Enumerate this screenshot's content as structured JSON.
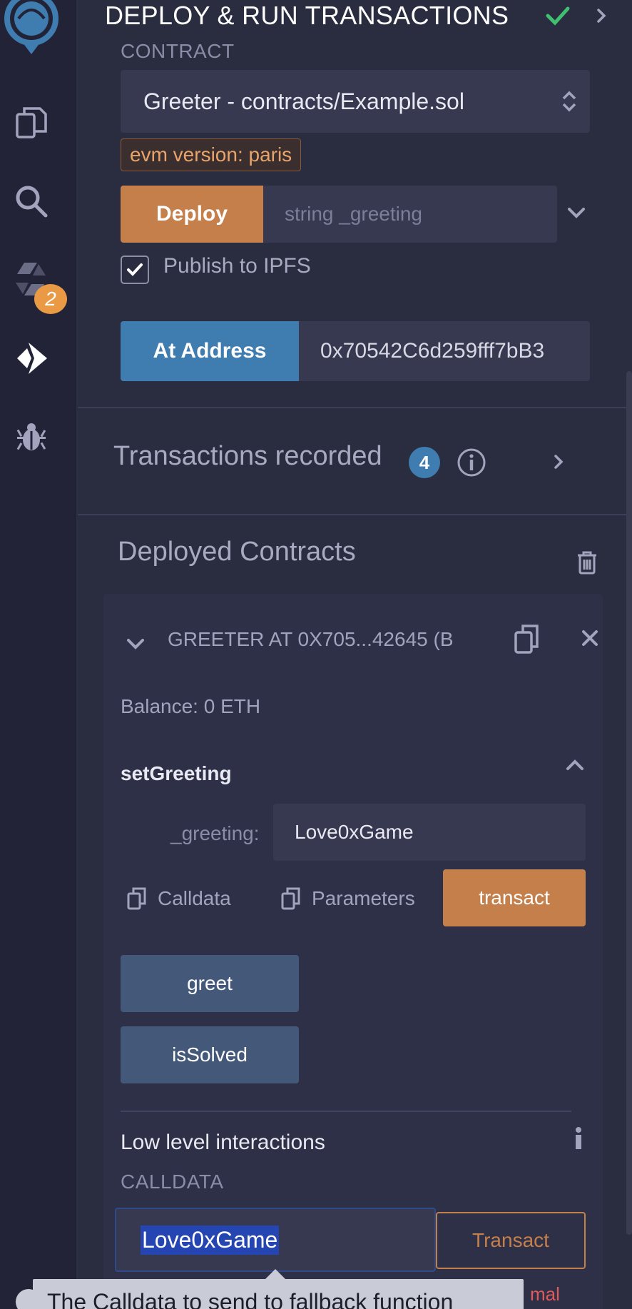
{
  "header": {
    "title": "DEPLOY & RUN TRANSACTIONS"
  },
  "contract": {
    "label": "CONTRACT",
    "selected": "Greeter - contracts/Example.sol",
    "evm_badge": "evm version: paris"
  },
  "deploy": {
    "button_label": "Deploy",
    "input_placeholder": "string _greeting",
    "publish_label": "Publish to IPFS",
    "publish_checked": true
  },
  "at_address": {
    "button_label": "At Address",
    "value": "0x70542C6d259fff7bB3"
  },
  "transactions": {
    "title": "Transactions recorded",
    "count": "4"
  },
  "deployed": {
    "title": "Deployed Contracts",
    "instance_title": "GREETER AT 0X705...42645 (B",
    "balance": "Balance: 0 ETH",
    "function_name": "setGreeting",
    "param_label": "_greeting:",
    "param_value": "Love0xGame",
    "calldata_copy": "Calldata",
    "params_copy": "Parameters",
    "transact_label": "transact",
    "greet_label": "greet",
    "issolved_label": "isSolved"
  },
  "low_level": {
    "title": "Low level interactions",
    "calldata_label": "CALLDATA",
    "calldata_value": "Love0xGame",
    "transact_label": "Transact",
    "error_fragment": "mal"
  },
  "tooltip": {
    "text": "The Calldata to send to fallback function"
  },
  "sidebar": {
    "badge": "2",
    "icons": [
      "remix-logo-icon",
      "file-explorer-icon",
      "search-icon",
      "solidity-compiler-icon",
      "deploy-run-icon",
      "debugger-icon"
    ]
  },
  "colors": {
    "deploy_orange": "#c47f4b",
    "at_address_blue": "#3f7cb0",
    "call_button": "#44587a",
    "check_green": "#3fbf6f",
    "badge_orange": "#ea9a45"
  }
}
